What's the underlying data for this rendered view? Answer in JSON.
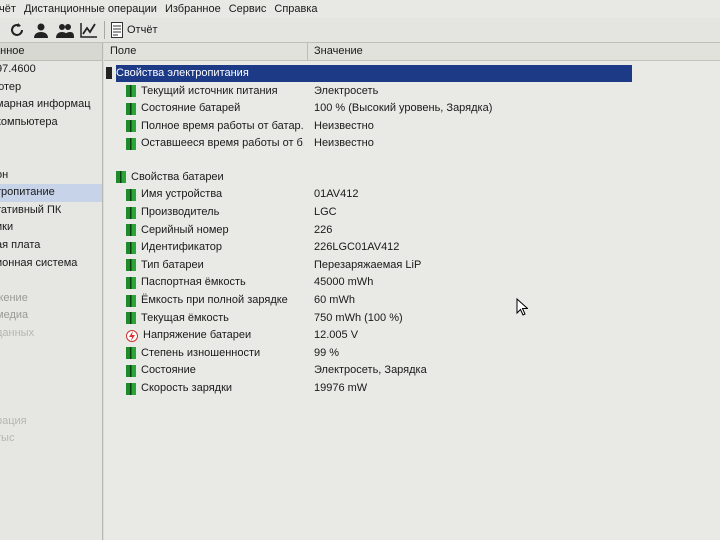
{
  "menu": [
    "тчёт",
    "Дистанционные операции",
    "Избранное",
    "Сервис",
    "Справка"
  ],
  "toolbar": {
    "report_label": "Отчёт"
  },
  "tree": {
    "header": "анное",
    "items": [
      {
        "label": "97.4600",
        "state": "normal"
      },
      {
        "label": "ютер",
        "state": "normal"
      },
      {
        "label": "марная информац",
        "state": "normal"
      },
      {
        "label": "компьютера",
        "state": "normal"
      },
      {
        "label": "",
        "state": "normal"
      },
      {
        "label": "",
        "state": "normal"
      },
      {
        "label": "он",
        "state": "normal"
      },
      {
        "label": "тропитание",
        "state": "selected"
      },
      {
        "label": "тативный ПК",
        "state": "normal"
      },
      {
        "label": "ики",
        "state": "normal"
      },
      {
        "label": "ая плата",
        "state": "normal"
      },
      {
        "label": "ионная система",
        "state": "normal"
      },
      {
        "label": "",
        "state": "normal"
      },
      {
        "label": "жение",
        "state": "faded"
      },
      {
        "label": "медиа",
        "state": "faded"
      },
      {
        "label": "данных",
        "state": "faded2"
      },
      {
        "label": "",
        "state": "faded2"
      },
      {
        "label": "",
        "state": "faded2"
      },
      {
        "label": "",
        "state": "faded2"
      },
      {
        "label": "",
        "state": "faded2"
      },
      {
        "label": "рация",
        "state": "faded2"
      },
      {
        "label": "тыс",
        "state": "faded2"
      }
    ]
  },
  "columns": {
    "field": "Поле",
    "value": "Значение"
  },
  "groups": [
    {
      "title": "Свойства электропитания",
      "selected": true,
      "rows": [
        {
          "field": "Текущий источник питания",
          "value": "Электросеть"
        },
        {
          "field": "Состояние батарей",
          "value": "100 % (Высокий уровень, Зарядка)"
        },
        {
          "field": "Полное время работы от батар...",
          "value": "Неизвестно"
        },
        {
          "field": "Оставшееся время работы от б...",
          "value": "Неизвестно"
        }
      ]
    },
    {
      "title": "Свойства батареи",
      "selected": false,
      "rows": [
        {
          "field": "Имя устройства",
          "value": "01AV412"
        },
        {
          "field": "Производитель",
          "value": "LGC"
        },
        {
          "field": "Серийный номер",
          "value": "226"
        },
        {
          "field": "Идентификатор",
          "value": "226LGC01AV412"
        },
        {
          "field": "Тип батареи",
          "value": "Перезаряжаемая LiP"
        },
        {
          "field": "Паспортная ёмкость",
          "value": "45000 mWh"
        },
        {
          "field": "Ёмкость при полной зарядке",
          "value": "60 mWh"
        },
        {
          "field": "Текущая ёмкость",
          "value": "750 mWh  (100 %)"
        },
        {
          "field": "Напряжение батареи",
          "value": "12.005 V",
          "icon": "voltage-icon"
        },
        {
          "field": "Степень изношенности",
          "value": "99 %"
        },
        {
          "field": "Состояние",
          "value": "Электросеть, Зарядка"
        },
        {
          "field": "Скорость зарядки",
          "value": "19976 mW"
        }
      ]
    }
  ],
  "colors": {
    "selection": "#1c3a86",
    "battery_icon": "#1f8a2a"
  }
}
